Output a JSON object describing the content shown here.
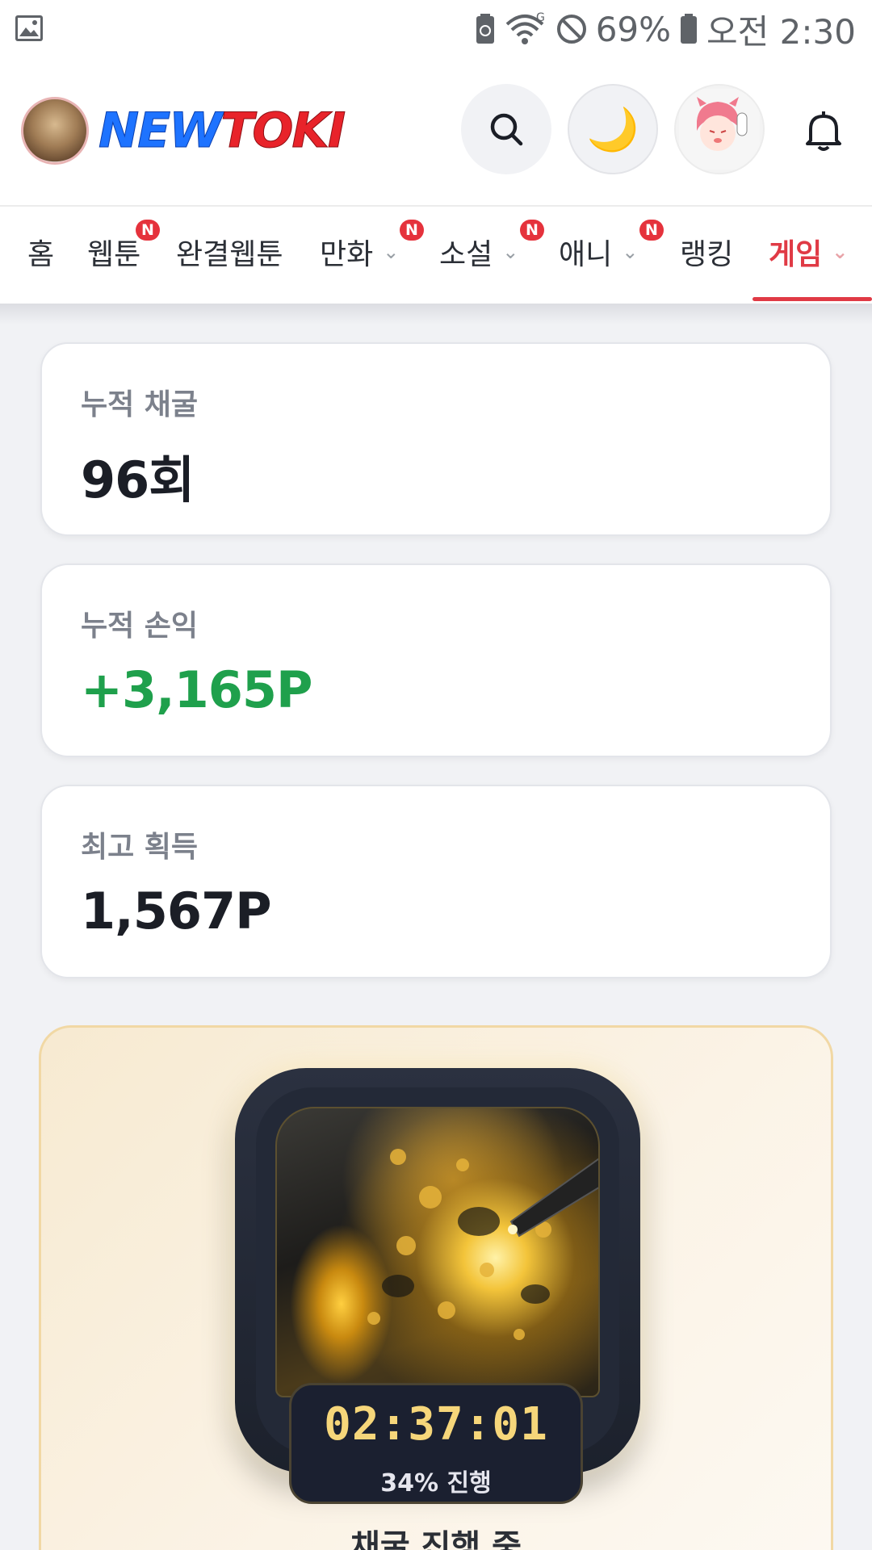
{
  "status_bar": {
    "battery_percent": "69%",
    "time": "오전 2:30",
    "network": "G"
  },
  "header": {
    "brand_part1": "NEW",
    "brand_part2": "TOKI",
    "theme_icon": "🌙"
  },
  "nav": {
    "items": [
      {
        "label": "홈",
        "badge": ""
      },
      {
        "label": "웹툰",
        "badge": "N"
      },
      {
        "label": "완결웹툰",
        "badge": ""
      },
      {
        "label": "만화",
        "badge": "N",
        "chevron": "⌄"
      },
      {
        "label": "소설",
        "badge": "N",
        "chevron": "⌄"
      },
      {
        "label": "애니",
        "badge": "N",
        "chevron": "⌄"
      },
      {
        "label": "랭킹",
        "badge": ""
      },
      {
        "label": "게임",
        "badge": "",
        "chevron": "⌄",
        "active": true
      }
    ]
  },
  "stats": {
    "total_mining_label": "누적 채굴",
    "total_mining_value": "96회",
    "total_profit_label": "누적 손익",
    "total_profit_value": "+3,165P",
    "best_gain_label": "최고 획득",
    "best_gain_value": "1,567P"
  },
  "mining": {
    "timer": "02:37:01",
    "progress": "34% 진행",
    "progress_fraction": 0.34,
    "title": "채굴 진행 중"
  },
  "colors": {
    "brand_blue": "#1e73ff",
    "brand_red": "#e8232a",
    "active_tab": "#e03a45",
    "positive": "#1fa04c",
    "timer_gold": "#f6d67a"
  }
}
